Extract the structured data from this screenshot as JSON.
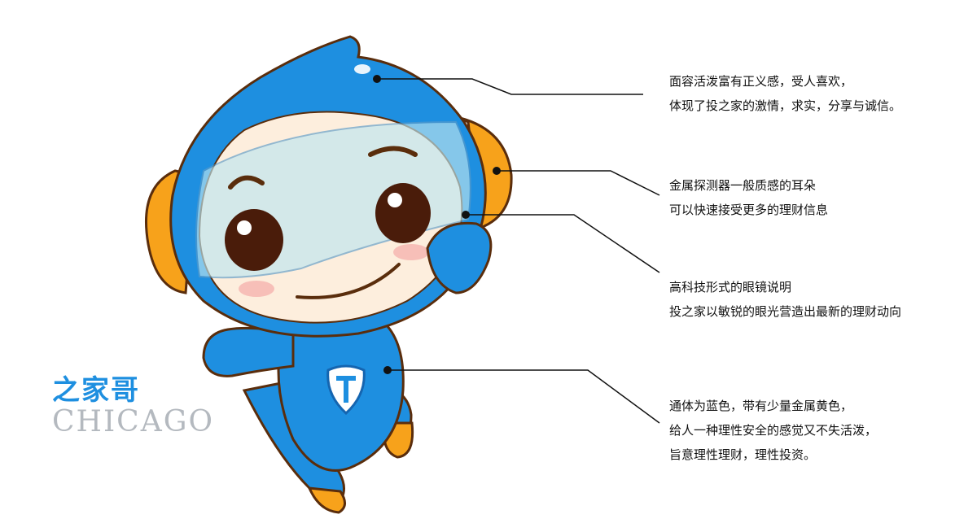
{
  "brand": {
    "name_cn": "之家哥",
    "name_en": "CHICAGO",
    "accent_color": "#1e8fe0"
  },
  "annotations": [
    {
      "lines": [
        "面容活泼富有正义感，受人喜欢，",
        "体现了投之家的激情，求实，分享与诚信。"
      ]
    },
    {
      "lines": [
        "金属探测器一般质感的耳朵",
        "可以快速接受更多的理财信息"
      ]
    },
    {
      "lines": [
        "高科技形式的眼镜说明",
        "投之家以敏锐的眼光营造出最新的理财动向"
      ]
    },
    {
      "lines": [
        "通体为蓝色，带有少量金属黄色，",
        "给人一种理性安全的感觉又不失活泼，",
        "旨意理性理财，理性投资。"
      ]
    }
  ],
  "colors": {
    "body_blue": "#1e8fe0",
    "metal_yellow": "#f7a21b",
    "skin": "#fdeedd"
  }
}
